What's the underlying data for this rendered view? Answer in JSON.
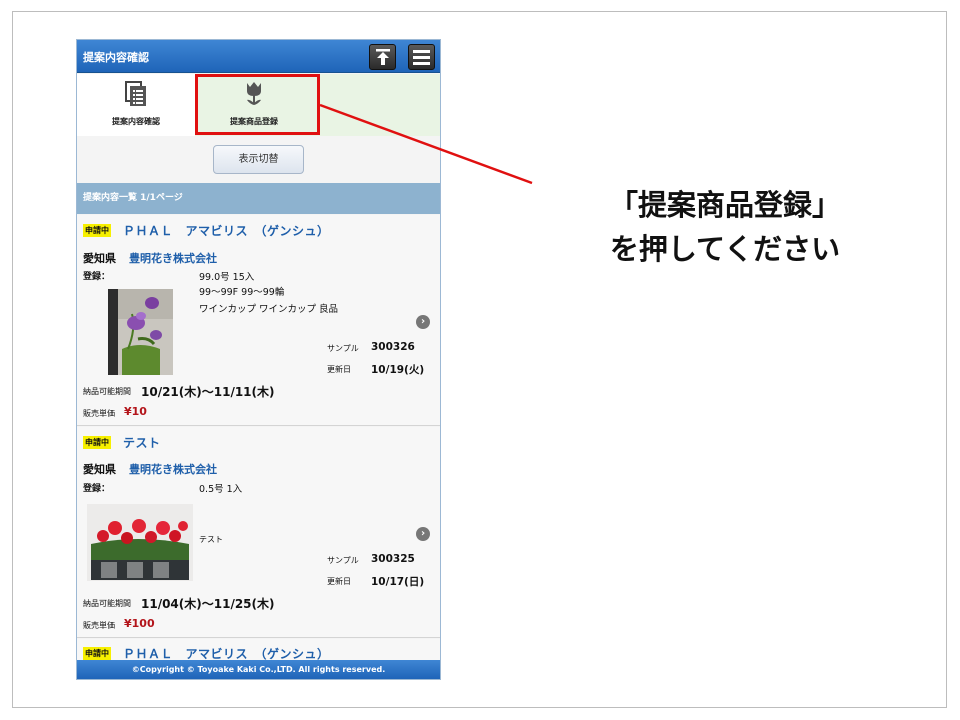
{
  "header": {
    "title": "提案内容確認"
  },
  "tabs": [
    {
      "label": "提案内容確認",
      "icon": "document-list-icon"
    },
    {
      "label": "提案商品登録",
      "icon": "tulip-icon"
    }
  ],
  "toggle_button": "表示切替",
  "list_header": "提案内容一覧 1/1ページ",
  "products": [
    {
      "status": "申請中",
      "name": "ＰＨＡＬ　アマビリス　（ゲンシュ）",
      "prefecture": "愛知県",
      "company": "豊明花き株式会社",
      "reg_label": "登録：",
      "specs": [
        "99.0号 15入",
        "99〜99F 99〜99輪",
        "ワインカップ ワインカップ 良品"
      ],
      "sample_label": "サンプル",
      "sample_no": "300326",
      "updated_label": "更新日",
      "updated": "10/19(火)",
      "period_label": "納品可能期間",
      "period": "10/21(木)〜11/11(木)",
      "price_label": "販売単価",
      "price": "¥10"
    },
    {
      "status": "申請中",
      "name": "テスト",
      "prefecture": "愛知県",
      "company": "豊明花き株式会社",
      "reg_label": "登録：",
      "specs": [
        "0.5号 1入",
        "テスト"
      ],
      "sample_label": "サンプル",
      "sample_no": "300325",
      "updated_label": "更新日",
      "updated": "10/17(日)",
      "period_label": "納品可能期間",
      "period": "11/04(木)〜11/25(木)",
      "price_label": "販売単価",
      "price": "¥100"
    },
    {
      "status": "申請中",
      "name": "ＰＨＡＬ　アマビリス　（ゲンシュ）"
    }
  ],
  "footer": "©Copyright © Toyoake Kaki Co.,LTD. All rights reserved.",
  "instruction": {
    "line1": "「提案商品登録」",
    "line2": "を押してください"
  },
  "colors": {
    "header_blue": "#1f64b8",
    "highlight_red": "#e01010",
    "badge_yellow": "#f7f000",
    "price_red": "#b3141a",
    "link_blue": "#1f5faa"
  }
}
